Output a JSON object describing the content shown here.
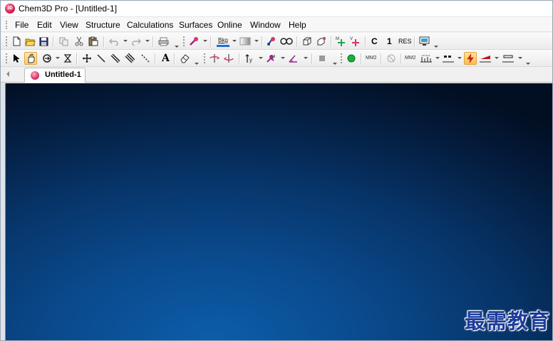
{
  "window": {
    "title": "Chem3D Pro - [Untitled-1]",
    "app_icon_label": "3D"
  },
  "menu": {
    "items": [
      "File",
      "Edit",
      "View",
      "Structure",
      "Calculations",
      "Surfaces",
      "Online",
      "Window",
      "Help"
    ]
  },
  "toolbar1": {
    "bkg_label": "Bkg",
    "c_label": "C",
    "one_label": "1",
    "res_label": "RES"
  },
  "toolbar2": {
    "text_tool_label": "A",
    "mm2_label_1": "MM2",
    "mm2_label_2": "MM2"
  },
  "tabs": [
    {
      "label": "Untitled-1",
      "active": true
    }
  ],
  "watermark": {
    "text": "最需教育"
  },
  "colors": {
    "canvas_center": "#0c5daa",
    "canvas_edge": "#020e22",
    "watermark": "#1d3c9c",
    "active_tool": "#ffcf62"
  }
}
